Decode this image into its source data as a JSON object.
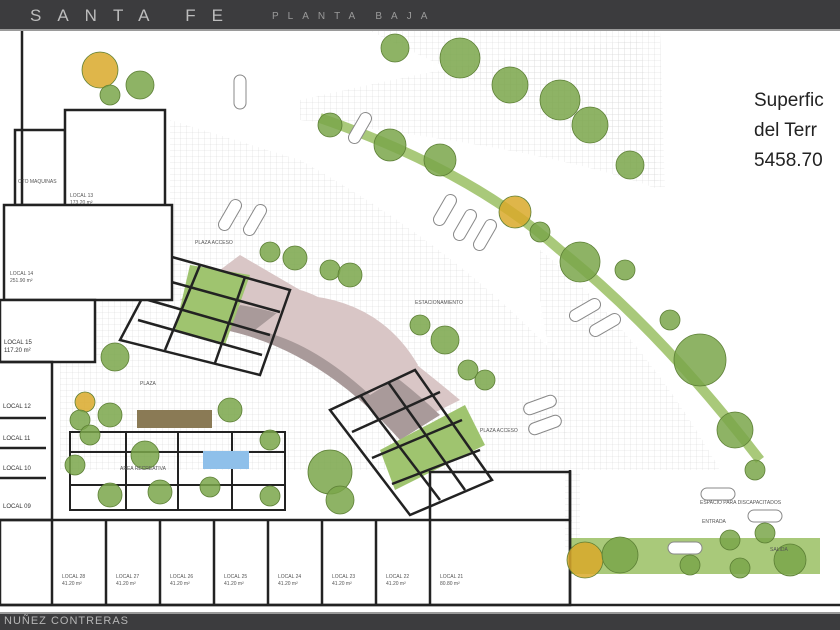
{
  "header": {
    "title": "SANTA FE",
    "subtitle": "PLANTA BAJA"
  },
  "footer": {
    "author": "NUÑEZ CONTRERAS"
  },
  "site_area": {
    "line1": "Superfic",
    "line2": "del Terr",
    "line3": "5458.70"
  },
  "labels": {
    "cto_maquinas": "CTO MAQUINAS",
    "local13": "LOCAL 13",
    "local13_area": "173.20 m²",
    "local14": "LOCAL 14",
    "local14_area": "251.90 m²",
    "local15": "LOCAL 15",
    "local15_area": "117.20 m²",
    "local12": "LOCAL 12",
    "local11": "LOCAL 11",
    "local10": "LOCAL 10",
    "local09": "LOCAL 09",
    "plaza_acceso_1": "PLAZA ACCESO",
    "plaza_acceso_2": "PLAZA ACCESO",
    "estacionamiento": "ESTACIONAMIENTO",
    "plaza": "PLAZA",
    "area_recreativa": "AREA RECREATIVA",
    "espacio_discapacitados": "ESPACIO PARA DISCAPACITADOS",
    "entrada": "ENTRADA",
    "salida": "SALIDA"
  },
  "bottom_locals": [
    {
      "name": "LOCAL 28",
      "area": "41.20 m²"
    },
    {
      "name": "LOCAL 27",
      "area": "41.20 m²"
    },
    {
      "name": "LOCAL 26",
      "area": "41.20 m²"
    },
    {
      "name": "LOCAL 25",
      "area": "41.20 m²"
    },
    {
      "name": "LOCAL 24",
      "area": "41.20 m²"
    },
    {
      "name": "LOCAL 23",
      "area": "41.20 m²"
    },
    {
      "name": "LOCAL 22",
      "area": "41.20 m²"
    },
    {
      "name": "LOCAL 21",
      "area": "80.80 m²"
    }
  ],
  "colors": {
    "bar": "#3c3c3e",
    "grass": "#9fc46f",
    "tree": "#7aa64a",
    "tree_yellow": "#d9a92a",
    "paving": "#d9c6c6",
    "path": "#a99a9a",
    "water": "#8fc0ea"
  }
}
